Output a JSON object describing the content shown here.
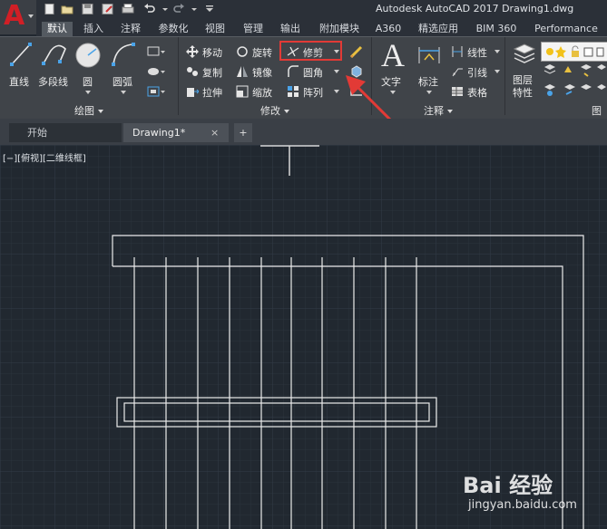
{
  "title_bar": {
    "app_logo": "A",
    "title": "Autodesk AutoCAD 2017    Drawing1.dwg"
  },
  "ribbon_tabs": [
    {
      "label": "默认",
      "active": true
    },
    {
      "label": "插入"
    },
    {
      "label": "注释"
    },
    {
      "label": "参数化"
    },
    {
      "label": "视图"
    },
    {
      "label": "管理"
    },
    {
      "label": "输出"
    },
    {
      "label": "附加模块"
    },
    {
      "label": "A360"
    },
    {
      "label": "精选应用"
    },
    {
      "label": "BIM 360"
    },
    {
      "label": "Performance"
    }
  ],
  "draw_panel": {
    "title": "绘图",
    "line": "直线",
    "polyline": "多段线",
    "circle": "圆",
    "arc": "圆弧"
  },
  "modify_panel": {
    "title": "修改",
    "move": "移动",
    "rotate": "旋转",
    "trim": "修剪",
    "copy": "复制",
    "mirror": "镜像",
    "fillet": "圆角",
    "stretch": "拉伸",
    "scale": "缩放",
    "array": "阵列"
  },
  "annotation_panel": {
    "title": "注释",
    "text": "文字",
    "dimension": "标注",
    "linear": "线性",
    "leader": "引线",
    "table": "表格"
  },
  "layers_panel": {
    "title": "图",
    "layer_properties_line1": "图层",
    "layer_properties_line2": "特性"
  },
  "document_tabs": {
    "start": "开始",
    "drawing": "Drawing1*",
    "close": "×",
    "new_tab": "+"
  },
  "viewport": {
    "label": "[−][俯视][二维线框]"
  },
  "colors": {
    "highlight": "#e23a36",
    "canvas": "#212830",
    "lines": "#ffffff"
  },
  "watermark": {
    "brand": "Bai 经验",
    "url": "jingyan.baidu.com"
  }
}
